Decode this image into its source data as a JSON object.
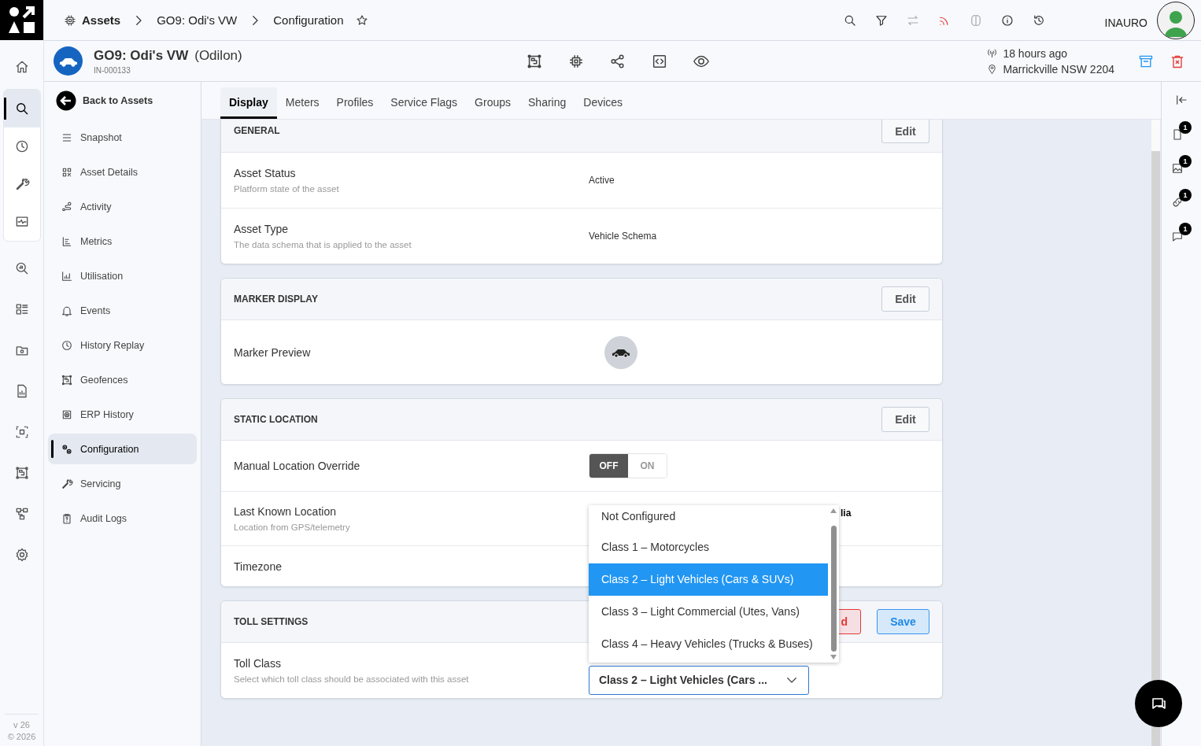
{
  "rail": [
    {
      "selected": false
    },
    {
      "selected": true
    },
    {
      "selected": false
    },
    {
      "selected": false
    },
    {
      "selected": false
    },
    {
      "selected": false
    },
    {
      "selected": false
    },
    {
      "selected": false
    },
    {
      "selected": false
    },
    {
      "selected": false
    },
    {
      "selected": false
    },
    {
      "selected": false
    },
    {
      "selected": false
    }
  ],
  "version": "v 26",
  "copyright": "© 2026",
  "breadcrumb": [
    {
      "label": "Assets",
      "kind": "root"
    },
    {
      "label": "GO9: Odi's VW",
      "kind": "crumb"
    },
    {
      "label": "Configuration",
      "kind": "crumb"
    }
  ],
  "toolbar": [
    {
      "disabled": false,
      "alert": false
    },
    {
      "disabled": false,
      "alert": false
    },
    {
      "disabled": true,
      "alert": false
    },
    {
      "disabled": false,
      "alert": true
    },
    {
      "disabled": true,
      "alert": false
    },
    {
      "disabled": false,
      "alert": false
    },
    {
      "disabled": false,
      "alert": false
    }
  ],
  "user": "INAURO",
  "asset": {
    "name": "GO9: Odi's VW",
    "alias": "(Odilon)",
    "id": "IN-000133",
    "last_seen": "18 hours ago",
    "location": "Marrickville NSW 2204"
  },
  "back": "Back to Assets",
  "menu": [
    {
      "label": "Snapshot",
      "selected": false
    },
    {
      "label": "Asset Details",
      "selected": false
    },
    {
      "label": "Activity",
      "selected": false
    },
    {
      "label": "Metrics",
      "selected": false
    },
    {
      "label": "Utilisation",
      "selected": false
    },
    {
      "label": "Events",
      "selected": false
    },
    {
      "label": "History Replay",
      "selected": false
    },
    {
      "label": "Geofences",
      "selected": false
    },
    {
      "label": "ERP History",
      "selected": false
    },
    {
      "label": "Configuration",
      "selected": true
    },
    {
      "label": "Servicing",
      "selected": false
    },
    {
      "label": "Audit Logs",
      "selected": false
    }
  ],
  "tabs": [
    {
      "label": "Display",
      "selected": true
    },
    {
      "label": "Meters",
      "selected": false
    },
    {
      "label": "Profiles",
      "selected": false
    },
    {
      "label": "Service Flags",
      "selected": false
    },
    {
      "label": "Groups",
      "selected": false
    },
    {
      "label": "Sharing",
      "selected": false
    },
    {
      "label": "Devices",
      "selected": false
    }
  ],
  "sections": [
    {
      "title": "GENERAL",
      "cut": true,
      "buttons": [
        {
          "label": "Edit",
          "kind": "edit"
        }
      ],
      "rows": [
        {
          "kind": "text",
          "label": "Asset Status",
          "description": "Platform state of the asset",
          "value": "Active"
        },
        {
          "kind": "text",
          "label": "Asset Type",
          "description": "The data schema that is applied to the asset",
          "value": "Vehicle Schema"
        }
      ]
    },
    {
      "title": "MARKER DISPLAY",
      "cut": false,
      "buttons": [
        {
          "label": "Edit",
          "kind": "edit"
        }
      ],
      "rows": [
        {
          "kind": "marker",
          "label": "Marker Preview"
        }
      ]
    },
    {
      "title": "STATIC LOCATION",
      "cut": false,
      "buttons": [
        {
          "label": "Edit",
          "kind": "edit"
        }
      ],
      "rows": [
        {
          "kind": "toggle",
          "label": "Manual Location Override",
          "options": [
            {
              "label": "OFF",
              "selected": true
            },
            {
              "label": "ON",
              "selected": false
            }
          ]
        },
        {
          "kind": "covered",
          "label": "Last Known Location",
          "description": "Location from GPS/telemetry",
          "value": "lia"
        },
        {
          "kind": "covered",
          "label": "Timezone"
        }
      ]
    },
    {
      "title": "TOLL SETTINGS",
      "cut": false,
      "buttons": [
        {
          "label": "d",
          "kind": "discard"
        },
        {
          "label": "Save",
          "kind": "save"
        }
      ],
      "rows": [
        {
          "kind": "select",
          "label": "Toll Class",
          "description": "Select which toll class should be associated with this asset",
          "value": "Class 2 – Light Vehicles (Cars ...",
          "expanded": true,
          "options": [
            {
              "label": "Not Configured",
              "selected": false
            },
            {
              "label": "Class 1 – Motorcycles",
              "selected": false
            },
            {
              "label": "Class 2 – Light Vehicles (Cars & SUVs)",
              "selected": true
            },
            {
              "label": "Class 3 – Light Commercial (Utes, Vans)",
              "selected": false
            },
            {
              "label": "Class 4 – Heavy Vehicles (Trucks & Buses)",
              "selected": false
            }
          ]
        }
      ]
    }
  ],
  "right_rail": [
    {
      "badge": "1"
    },
    {
      "badge": "1"
    },
    {
      "badge": "1"
    },
    {
      "badge": "1"
    }
  ]
}
